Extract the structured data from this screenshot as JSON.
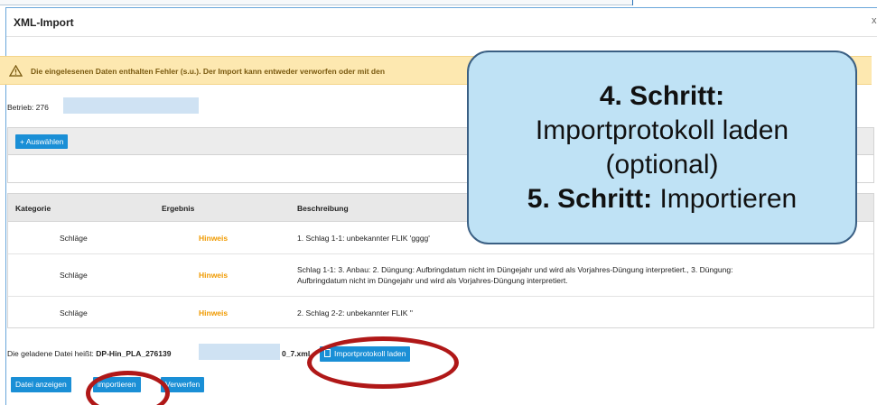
{
  "dialog": {
    "title": "XML-Import",
    "close_label": "x"
  },
  "warning": {
    "text": "Die eingelesenen Daten enthalten Fehler (s.u.). Der Import kann entweder verworfen oder mit den"
  },
  "betrieb": {
    "label": "Betrieb: 276"
  },
  "select_panel": {
    "button_label": "+ Auswählen"
  },
  "table": {
    "headers": {
      "kategorie": "Kategorie",
      "ergebnis": "Ergebnis",
      "beschreibung": "Beschreibung"
    },
    "rows": [
      {
        "kategorie": "Schläge",
        "ergebnis": "Hinweis",
        "beschreibung_1": "1. Schlag 1-1: unbekannter FLIK 'gggg'",
        "beschreibung_2": ""
      },
      {
        "kategorie": "Schläge",
        "ergebnis": "Hinweis",
        "beschreibung_1": "Schlag 1-1: 3. Anbau: 2. Düngung: Aufbringdatum nicht im Düngejahr und wird als Vorjahres-Düngung interpretiert., 3. Düngung:",
        "beschreibung_2": "Aufbringdatum nicht im Düngejahr und wird als Vorjahres-Düngung interpretiert."
      },
      {
        "kategorie": "Schläge",
        "ergebnis": "Hinweis",
        "beschreibung_1": "2. Schlag 2-2: unbekannter FLIK ''",
        "beschreibung_2": ""
      }
    ]
  },
  "file": {
    "label": "Die geladene Datei heißt:",
    "name_prefix": "DP-Hin_PLA_276139",
    "name_suffix": "0_7.xml"
  },
  "buttons": {
    "protokoll": "Importprotokoll laden",
    "anzeigen": "Datei anzeigen",
    "importieren": "importieren",
    "verwerfen": "Verwerfen"
  },
  "callout": {
    "step4_title": "4. Schritt:",
    "step4_line1": "Importprotokoll laden",
    "step4_line2": "(optional)",
    "step5_title": "5. Schritt:",
    "step5_text": " Importieren"
  },
  "colors": {
    "primary_button": "#1a8fd6",
    "warning_bg": "#fde8b0",
    "hinweis": "#f09a00",
    "highlight_ring": "#b01818",
    "callout_bg": "#bfe2f5"
  }
}
